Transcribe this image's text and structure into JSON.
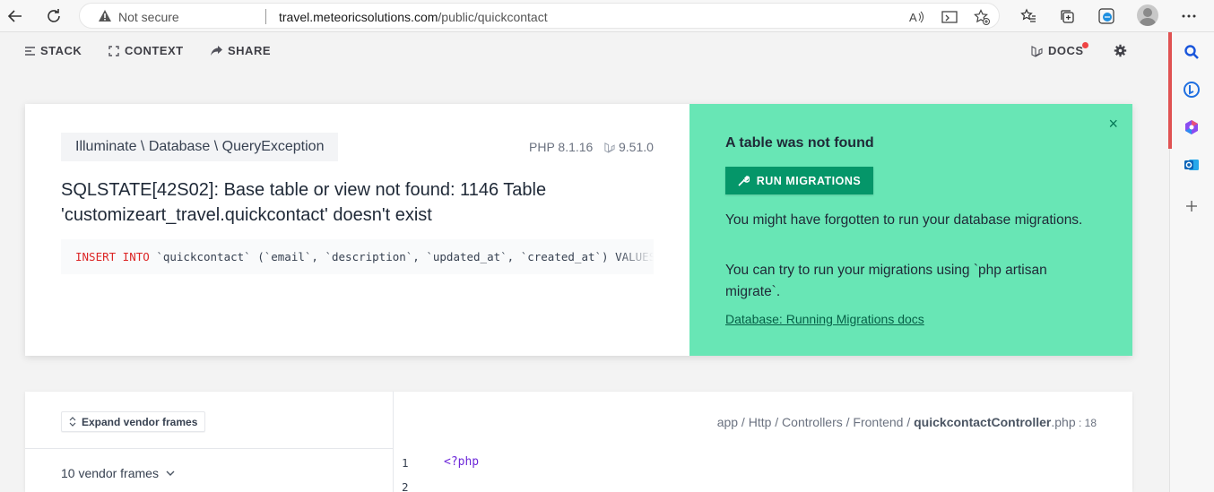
{
  "browser": {
    "not_secure": "Not secure",
    "url_domain": "travel.meteoricsolutions.com",
    "url_path": "/public/quickcontact"
  },
  "ignition": {
    "stack": "STACK",
    "context": "CONTEXT",
    "share": "SHARE",
    "docs": "DOCS"
  },
  "error": {
    "exception_class": "Illuminate \\ Database \\ QueryException",
    "php_version": "PHP 8.1.16",
    "laravel_version": "9.51.0",
    "message": "SQLSTATE[42S02]: Base table or view not found: 1146 Table 'customizeart_travel.quickcontact' doesn't exist",
    "sql_keyword": "INSERT INTO",
    "sql_rest": " `quickcontact` (`email`, `description`, `updated_at`, `created_at`) VALUES"
  },
  "solution": {
    "close": "×",
    "title": "A table was not found",
    "button": "RUN MIGRATIONS",
    "p1": "You might have forgotten to run your database migrations.",
    "p2": "You can try to run your migrations using `php artisan migrate`.",
    "link": "Database: Running Migrations docs"
  },
  "stack": {
    "expand_button": "Expand vendor frames",
    "vendor_frames": "10 vendor frames",
    "path_prefix": "app / Http / Controllers / Frontend / ",
    "file_name": "quickcontactController",
    "file_ext": ".php",
    "line_sep": " : ",
    "line_number": "18",
    "code": [
      {
        "no": "1",
        "text": "<?php"
      },
      {
        "no": "2",
        "text": ""
      }
    ]
  },
  "colors": {
    "solution_bg": "#68e6b5",
    "button_bg": "#059669",
    "sql_keyword": "#dc2626"
  }
}
